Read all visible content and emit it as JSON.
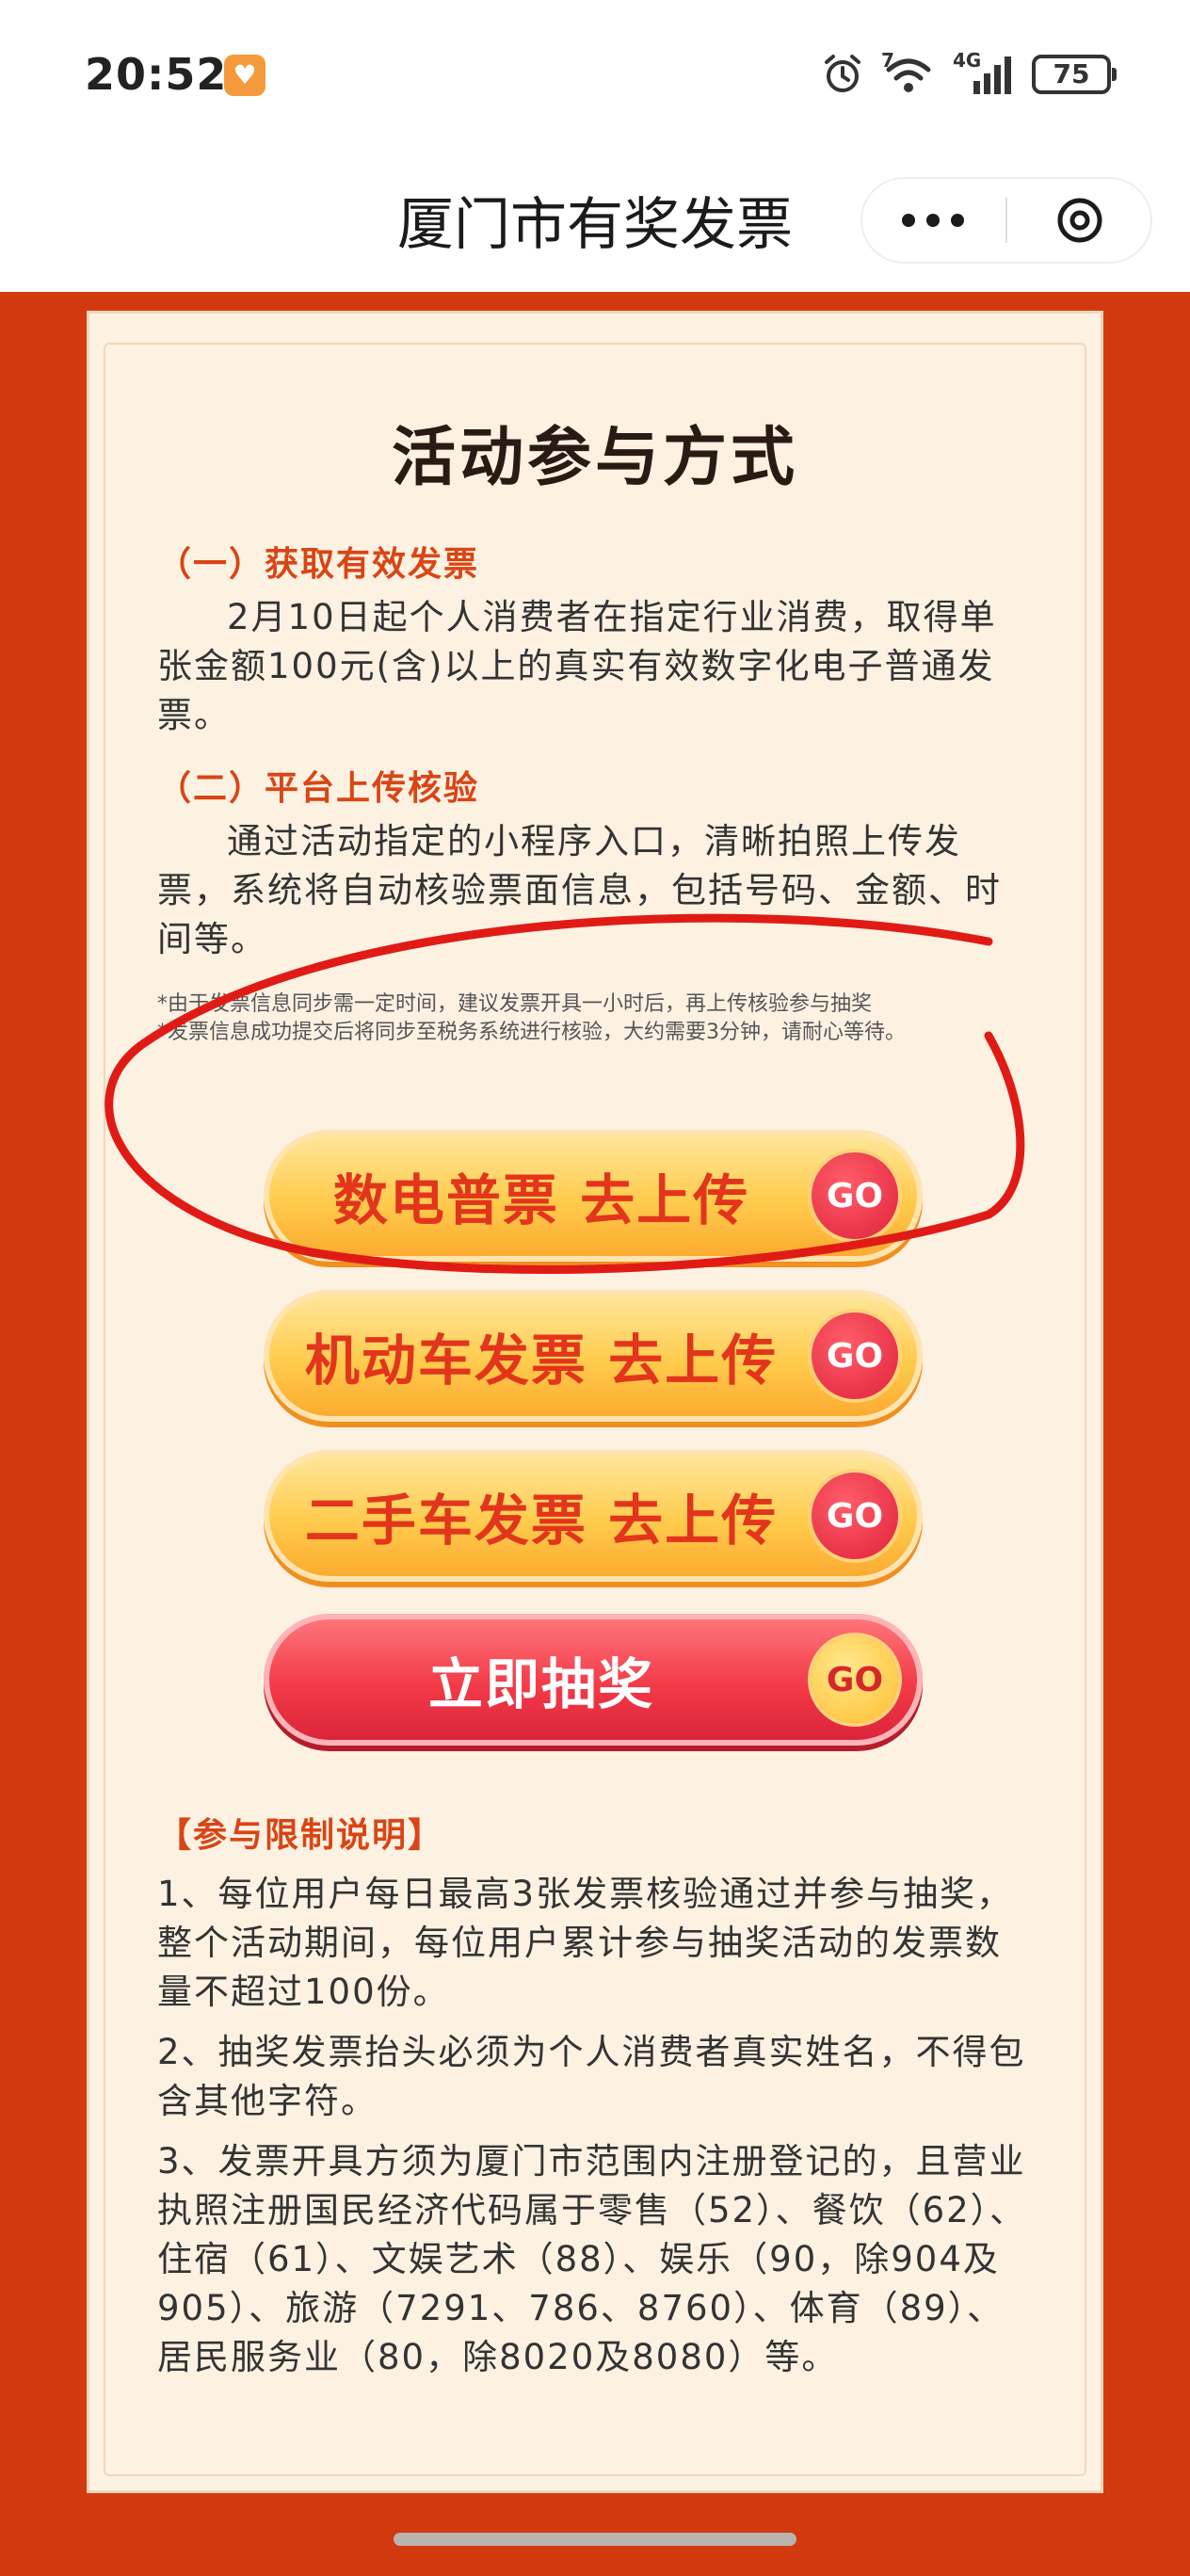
{
  "status_bar": {
    "time": "20:52",
    "battery": "75",
    "network": "4G",
    "wifi_badge": "7"
  },
  "nav": {
    "title": "厦门市有奖发票"
  },
  "card": {
    "title": "活动参与方式",
    "section1": {
      "heading": "（一）获取有效发票",
      "body": "2月10日起个人消费者在指定行业消费，取得单张金额100元(含)以上的真实有效数字化电子普通发票。"
    },
    "section2": {
      "heading": "（二）平台上传核验",
      "body": "通过活动指定的小程序入口，清晰拍照上传发票，系统将自动核验票面信息，包括号码、金额、时间等。"
    },
    "notes": [
      "*由于发票信息同步需一定时间，建议发票开具一小时后，再上传核验参与抽奖",
      "*发票信息成功提交后将同步至税务系统进行核验，大约需要3分钟，请耐心等待。"
    ],
    "buttons": [
      {
        "label": "数电普票 去上传",
        "go": "GO"
      },
      {
        "label": "机动车发票 去上传",
        "go": "GO"
      },
      {
        "label": "二手车发票 去上传",
        "go": "GO"
      },
      {
        "label": "立即抽奖",
        "go": "GO"
      }
    ],
    "limits": {
      "heading": "【参与限制说明】",
      "items": [
        "1、每位用户每日最高3张发票核验通过并参与抽奖，整个活动期间，每位用户累计参与抽奖活动的发票数量不超过100份。",
        "2、抽奖发票抬头必须为个人消费者真实姓名，不得包含其他字符。",
        "3、发票开具方须为厦门市范围内注册登记的，且营业执照注册国民经济代码属于零售（52）、餐饮（62）、住宿（61）、文娱艺术（88）、娱乐（90，除904及905）、旅游（7291、786、8760）、体育（89）、居民服务业（80，除8020及8080）等。"
      ]
    }
  },
  "colors": {
    "page_background": "#d2390f",
    "card_background": "#fdf1e2",
    "heading_accent": "#d94515",
    "button_yellow": "#ffcb4c",
    "button_red": "#f23a48"
  }
}
